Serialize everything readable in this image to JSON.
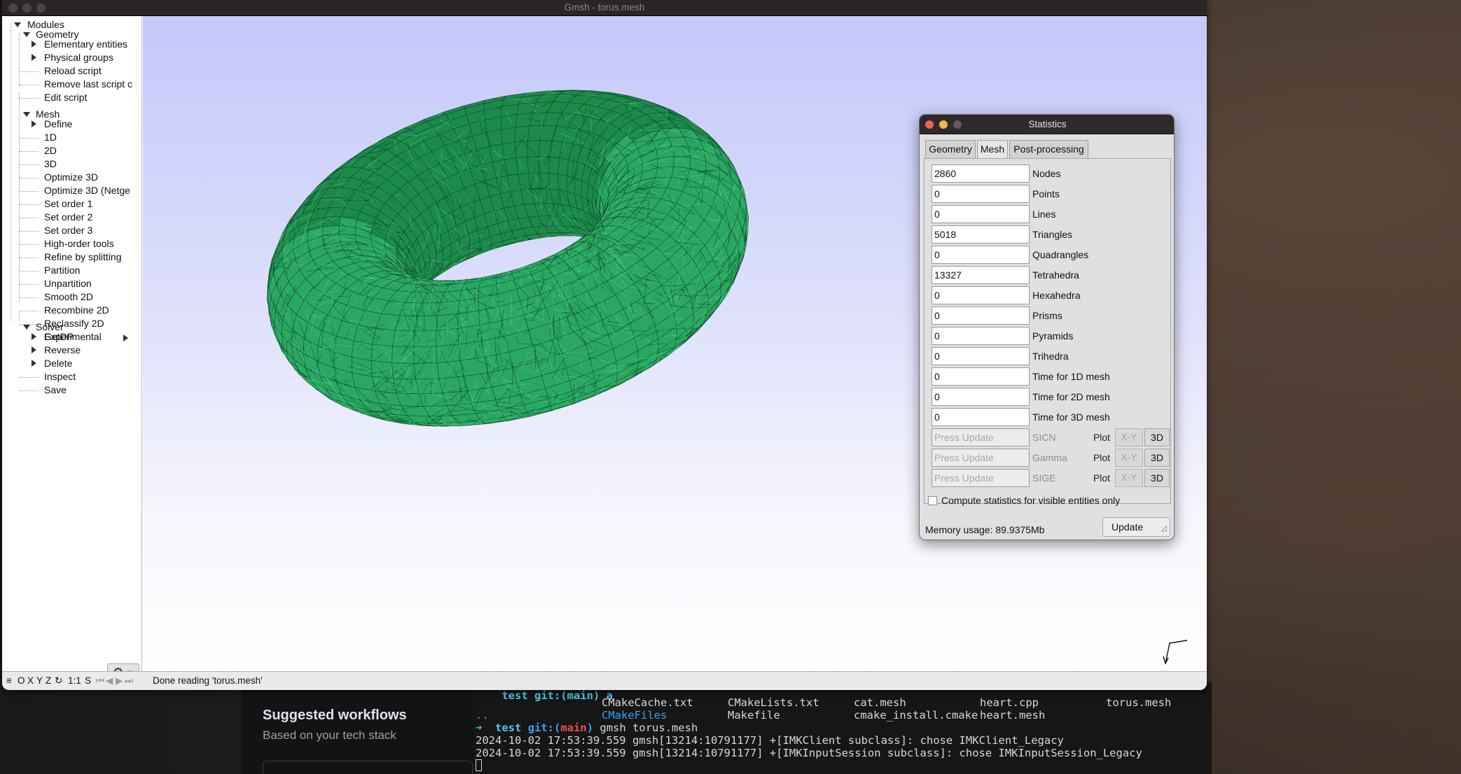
{
  "window": {
    "title": "Gmsh - torus.mesh"
  },
  "tree": {
    "modules": "Modules",
    "geometry": "Geometry",
    "geometry_items": [
      "Elementary entities",
      "Physical groups",
      "Reload script",
      "Remove last script c",
      "Edit script"
    ],
    "mesh": "Mesh",
    "mesh_items": [
      "Define",
      "1D",
      "2D",
      "3D",
      "Optimize 3D",
      "Optimize 3D (Netge",
      "Set order 1",
      "Set order 2",
      "Set order 3",
      "High-order tools",
      "Refine by splitting",
      "Partition",
      "Unpartition",
      "Smooth 2D",
      "Recombine 2D",
      "Reclassify 2D",
      "Experimental",
      "Reverse",
      "Delete",
      "Inspect",
      "Save"
    ],
    "solver": "Solver",
    "solver_items": [
      "GetDP"
    ]
  },
  "statusbar": {
    "buttons": [
      "O",
      "X",
      "Y",
      "Z"
    ],
    "rotate_icon": "rotate-icon",
    "scale": "1:1",
    "s": "S",
    "message": "Done reading 'torus.mesh'"
  },
  "stats": {
    "title": "Statistics",
    "tabs": [
      "Geometry",
      "Mesh",
      "Post-processing"
    ],
    "active_tab": "Mesh",
    "rows": [
      {
        "value": "2860",
        "label": "Nodes"
      },
      {
        "value": "0",
        "label": "Points"
      },
      {
        "value": "0",
        "label": "Lines"
      },
      {
        "value": "5018",
        "label": "Triangles"
      },
      {
        "value": "0",
        "label": "Quadrangles"
      },
      {
        "value": "13327",
        "label": "Tetrahedra"
      },
      {
        "value": "0",
        "label": "Hexahedra"
      },
      {
        "value": "0",
        "label": "Prisms"
      },
      {
        "value": "0",
        "label": "Pyramids"
      },
      {
        "value": "0",
        "label": "Trihedra"
      },
      {
        "value": "0",
        "label": "Time for 1D mesh"
      },
      {
        "value": "0",
        "label": "Time for 2D mesh"
      },
      {
        "value": "0",
        "label": "Time for 3D mesh"
      }
    ],
    "quality_rows": [
      {
        "placeholder": "Press Update",
        "label": "SICN",
        "plot": "Plot",
        "xy": "X-Y",
        "three_d": "3D"
      },
      {
        "placeholder": "Press Update",
        "label": "Gamma",
        "plot": "Plot",
        "xy": "X-Y",
        "three_d": "3D"
      },
      {
        "placeholder": "Press Update",
        "label": "SIGE",
        "plot": "Plot",
        "xy": "X-Y",
        "three_d": "3D"
      }
    ],
    "visible_only": "Compute statistics for visible entities only",
    "memory": "Memory usage: 89.9375Mb",
    "update": "Update"
  },
  "background": {
    "workflows_title": "Suggested workflows",
    "workflows_subtitle": "Based on your tech stack",
    "terminal": {
      "top_fragment": "test git:(main) a",
      "files_row1": [
        "CMakeCache.txt",
        "CMakeLists.txt",
        "cat.mesh",
        "heart.cpp",
        "torus.mesh"
      ],
      "files_row2_dirs": [
        "..",
        "CMakeFiles"
      ],
      "files_row2": [
        "Makefile",
        "cmake_install.cmake",
        "heart.mesh"
      ],
      "prompt_arrow": "➜",
      "prompt_dir": "test",
      "prompt_git": "git:(",
      "prompt_branch": "main",
      "prompt_git_end": ")",
      "command": "gmsh torus.mesh",
      "log1": "2024-10-02 17:53:39.559 gmsh[13214:10791177] +[IMKClient subclass]: chose IMKClient_Legacy",
      "log2": "2024-10-02 17:53:39.559 gmsh[13214:10791177] +[IMKInputSession subclass]: chose IMKInputSession_Legacy"
    }
  },
  "colors": {
    "mesh_green": "#1f9a55",
    "mesh_dark": "#0b3a1e",
    "viewport_top": "#c4c8fa",
    "viewport_bottom": "#ffffff"
  }
}
